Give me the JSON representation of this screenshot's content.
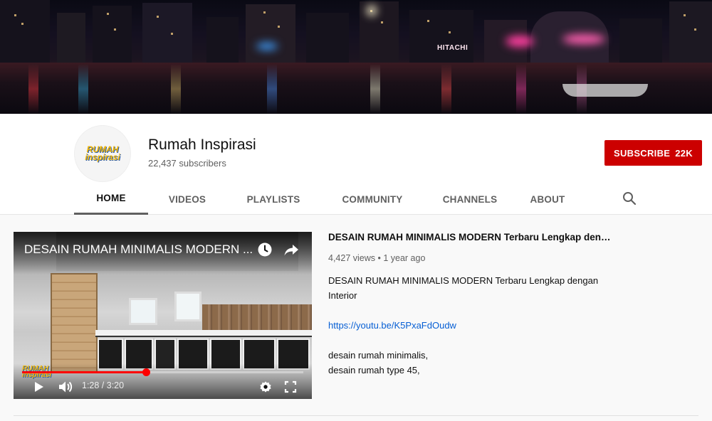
{
  "channel": {
    "name": "Rumah Inspirasi",
    "subscribers": "22,437 subscribers",
    "logo_line1": "RUMAH",
    "logo_line2": "inspirasi",
    "subscribe_label": "SUBSCRIBE",
    "subscribe_count": "22K"
  },
  "banner": {
    "signs": [
      "HITACHI"
    ]
  },
  "tabs": [
    "HOME",
    "VIDEOS",
    "PLAYLISTS",
    "COMMUNITY",
    "CHANNELS",
    "ABOUT"
  ],
  "active_tab": "HOME",
  "featured_video": {
    "overlay_title": "DESAIN RUMAH MINIMALIS MODERN ...",
    "time": "1:28 / 3:20",
    "progress": 0.44,
    "title": "DESAIN RUMAH MINIMALIS MODERN Terbaru Lengkap denga...",
    "meta": "4,427 views • 1 year ago",
    "description_line1": "DESAIN RUMAH MINIMALIS MODERN Terbaru Lengkap dengan Interior",
    "link": "https://youtu.be/K5PxaFdOudw",
    "tag1": "desain rumah minimalis,",
    "tag2": "desain rumah type 45,"
  },
  "icons": [
    "search-icon",
    "watch-later-icon",
    "share-icon",
    "play-icon",
    "volume-icon",
    "settings-gear-icon",
    "fullscreen-icon"
  ],
  "colors": {
    "subscribe": "#cc0000",
    "progress": "#ff0000",
    "link": "#065fd4"
  }
}
